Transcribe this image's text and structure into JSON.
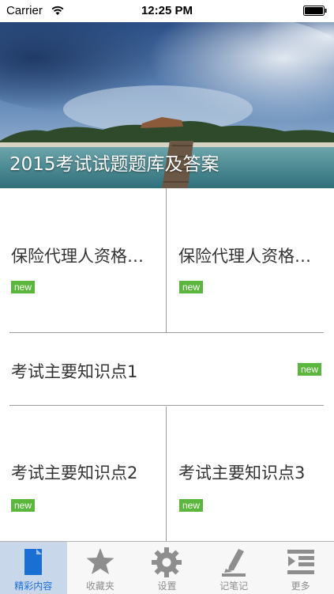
{
  "status_bar": {
    "carrier": "Carrier",
    "time": "12:25 PM"
  },
  "banner": {
    "title": "2015考试试题题库及答案"
  },
  "cards": [
    {
      "title": "保险代理人资格考试",
      "badge": "new"
    },
    {
      "title": "保险代理人资格考试",
      "badge": "new"
    },
    {
      "title": "考试主要知识点1",
      "badge": "new"
    },
    {
      "title": "考试主要知识点2",
      "badge": "new"
    },
    {
      "title": "考试主要知识点3",
      "badge": "new"
    }
  ],
  "tabs": [
    {
      "label": "精彩内容",
      "icon": "document-icon",
      "active": true
    },
    {
      "label": "收藏夹",
      "icon": "star-icon",
      "active": false
    },
    {
      "label": "设置",
      "icon": "gear-icon",
      "active": false
    },
    {
      "label": "记笔记",
      "icon": "pencil-icon",
      "active": false
    },
    {
      "label": "更多",
      "icon": "more-list-icon",
      "active": false
    }
  ],
  "colors": {
    "badge": "#5ab63c",
    "tab_active_bg": "#c9d7eb",
    "tab_active_text": "#1a6fd4",
    "tab_inactive": "#8e8e8e"
  }
}
